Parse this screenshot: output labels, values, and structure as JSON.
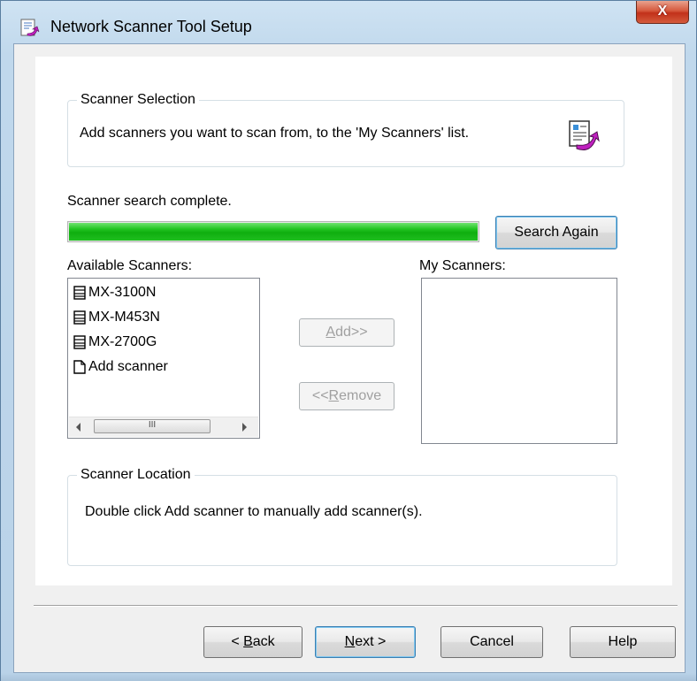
{
  "window": {
    "title": "Network Scanner Tool Setup",
    "close_label": "X"
  },
  "scanner_selection": {
    "legend": "Scanner Selection",
    "description": "Add scanners you want to scan from, to the 'My Scanners' list."
  },
  "status_text": "Scanner search complete.",
  "progress_percent": 100,
  "search_again_label": "Search Again",
  "available_scanners": {
    "label": "Available Scanners:",
    "items": [
      {
        "label": "MX-3100N",
        "icon": "scanner-icon"
      },
      {
        "label": "MX-M453N",
        "icon": "scanner-icon"
      },
      {
        "label": "MX-2700G",
        "icon": "scanner-icon"
      },
      {
        "label": "Add scanner",
        "icon": "document-icon"
      }
    ],
    "scroll_thumb_glyph": "III"
  },
  "my_scanners": {
    "label": "My Scanners:",
    "items": []
  },
  "add_button": {
    "prefix": "",
    "mnemonic": "A",
    "rest": "dd>>"
  },
  "remove_button": {
    "prefix": "<<",
    "mnemonic": "R",
    "rest": "emove"
  },
  "scanner_location": {
    "legend": "Scanner Location",
    "text": "Double click Add scanner to manually add scanner(s)."
  },
  "footer": {
    "back": {
      "prefix": "< ",
      "mnemonic": "B",
      "rest": "ack"
    },
    "next": {
      "prefix": "",
      "mnemonic": "N",
      "rest": "ext >"
    },
    "cancel": "Cancel",
    "help": "Help"
  },
  "colors": {
    "progress_fill": "#22c522",
    "close_button": "#c2311a",
    "wizard_arrow": "#c020c0"
  }
}
